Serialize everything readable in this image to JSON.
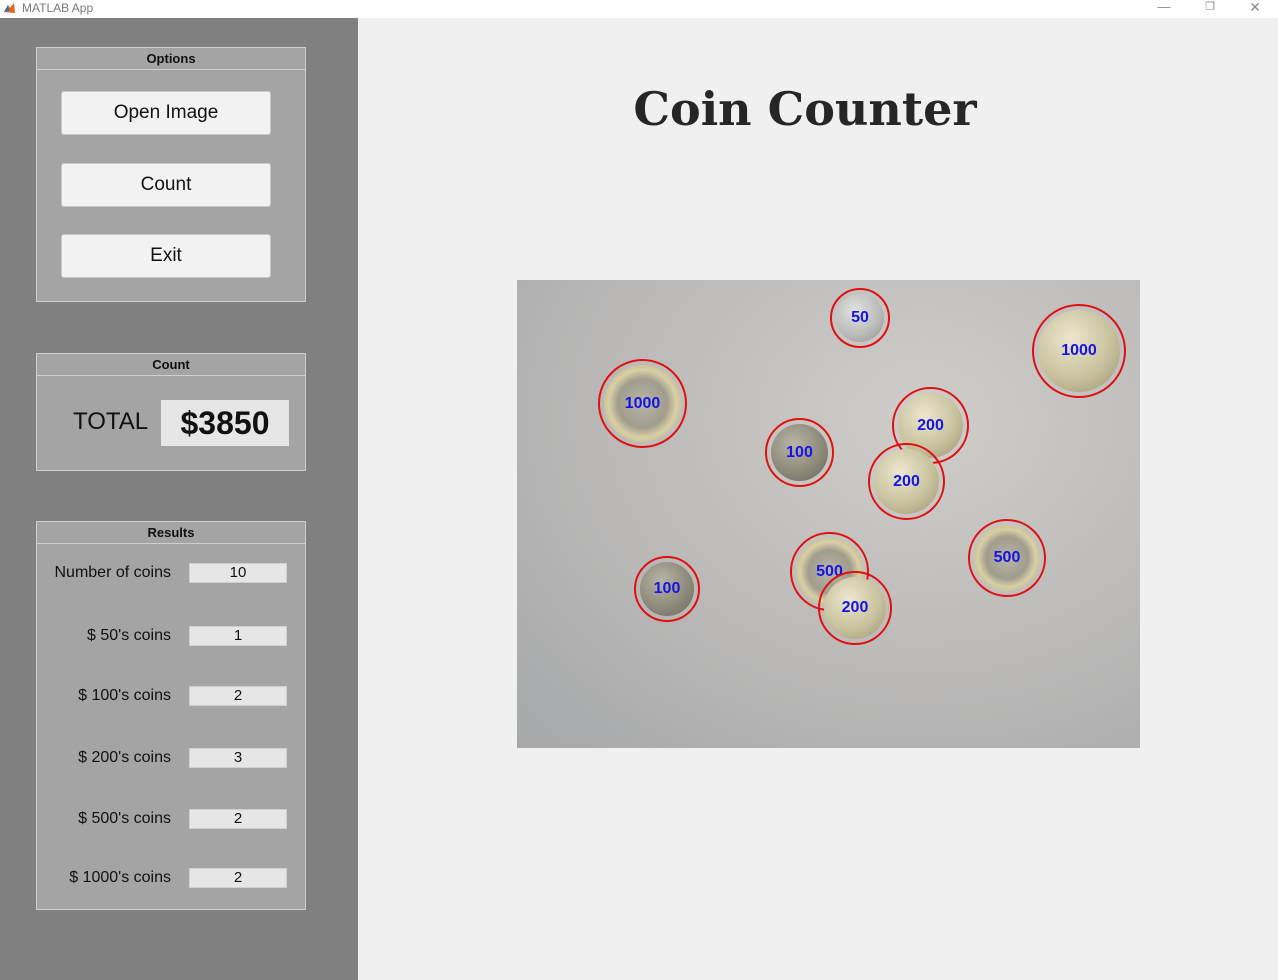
{
  "window": {
    "title": "MATLAB App",
    "min_glyph": "—",
    "max_glyph": "❐",
    "close_glyph": "✕"
  },
  "options": {
    "title": "Options",
    "open_label": "Open Image",
    "count_label": "Count",
    "exit_label": "Exit"
  },
  "count_panel": {
    "title": "Count",
    "total_label": "TOTAL",
    "total_value": "$3850"
  },
  "results": {
    "title": "Results",
    "rows": [
      {
        "label": "Number of coins",
        "value": "10"
      },
      {
        "label": "$ 50's coins",
        "value": "1"
      },
      {
        "label": "$ 100's coins",
        "value": "2"
      },
      {
        "label": "$ 200's coins",
        "value": "3"
      },
      {
        "label": "$ 500's coins",
        "value": "2"
      },
      {
        "label": "$ 1000's coins",
        "value": "2"
      }
    ]
  },
  "main": {
    "title": "Coin Counter"
  },
  "coins": [
    {
      "label": "50",
      "tone": "silver"
    },
    {
      "label": "1000",
      "tone": "gold"
    },
    {
      "label": "1000",
      "tone": "bimetal"
    },
    {
      "label": "200",
      "tone": "gold"
    },
    {
      "label": "100",
      "tone": "dark"
    },
    {
      "label": "200",
      "tone": "gold"
    },
    {
      "label": "500",
      "tone": "bimetal"
    },
    {
      "label": "100",
      "tone": "dark"
    },
    {
      "label": "500",
      "tone": "bimetal"
    },
    {
      "label": "200",
      "tone": "gold"
    }
  ],
  "colors": {
    "detection_circle": "#e01010",
    "coin_label": "#1414e6",
    "sidebar": "#808080",
    "panel": "#a4a4a4"
  }
}
